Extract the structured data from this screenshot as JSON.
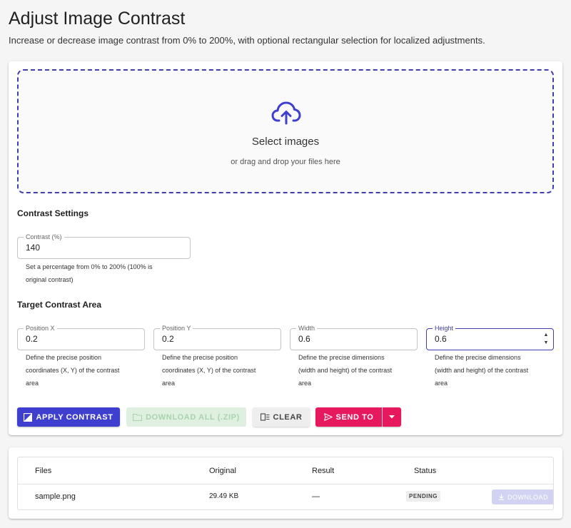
{
  "header": {
    "title": "Adjust Image Contrast",
    "subtitle": "Increase or decrease image contrast from 0% to 200%, with optional rectangular selection for localized adjustments."
  },
  "dropzone": {
    "title": "Select images",
    "subtitle": "or drag and drop your files here",
    "icon": "cloud-upload-icon"
  },
  "contrast_settings": {
    "section_title": "Contrast Settings",
    "contrast": {
      "label": "Contrast (%)",
      "value": "140",
      "helper": [
        "Set a percentage from 0% to 200% (100% is",
        "original contrast)"
      ]
    }
  },
  "target_area": {
    "section_title": "Target Contrast Area",
    "fields": [
      {
        "label": "Position X",
        "value": "0.2",
        "helper": [
          "Define the precise position",
          "coordinates (X, Y) of the contrast",
          "area"
        ]
      },
      {
        "label": "Position Y",
        "value": "0.2",
        "helper": [
          "Define the precise position",
          "coordinates (X, Y) of the contrast",
          "area"
        ]
      },
      {
        "label": "Width",
        "value": "0.6",
        "helper": [
          "Define the precise dimensions",
          "(width and height) of the contrast",
          "area"
        ]
      },
      {
        "label": "Height",
        "value": "0.6",
        "helper": [
          "Define the precise dimensions",
          "(width and height) of the contrast",
          "area"
        ]
      }
    ]
  },
  "actions": {
    "apply_label": "APPLY CONTRAST",
    "download_all_label": "DOWNLOAD ALL (.ZIP)",
    "clear_label": "CLEAR",
    "send_to_label": "SEND TO"
  },
  "files_table": {
    "headers": [
      "Files",
      "Original",
      "Result",
      "Status"
    ],
    "rows": [
      {
        "file": "sample.png",
        "original": "29.49 KB",
        "result": "—",
        "status": "PENDING",
        "download_label": "DOWNLOAD"
      }
    ]
  },
  "colors": {
    "primary": "#3f3fcf",
    "send_to": "#e6195e",
    "download_all_disabled": "#dff0e0"
  }
}
